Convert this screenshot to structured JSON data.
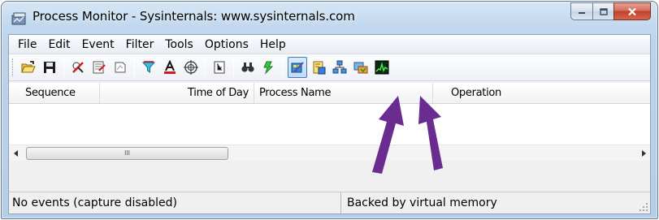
{
  "window": {
    "title": "Process Monitor - Sysinternals: www.sysinternals.com",
    "app_icon": "procmon-icon",
    "caption_buttons": [
      "minimize-icon",
      "maximize-icon",
      "close-icon"
    ]
  },
  "menubar": {
    "items": [
      {
        "label": "File"
      },
      {
        "label": "Edit"
      },
      {
        "label": "Event"
      },
      {
        "label": "Filter"
      },
      {
        "label": "Tools"
      },
      {
        "label": "Options"
      },
      {
        "label": "Help"
      }
    ]
  },
  "toolbar": {
    "buttons": [
      {
        "icon": "open-folder-icon"
      },
      {
        "icon": "save-icon"
      },
      {
        "icon": "capture-icon"
      },
      {
        "icon": "autoscroll-icon"
      },
      {
        "icon": "clear-icon"
      },
      {
        "icon": "filter-icon"
      },
      {
        "icon": "highlight-icon"
      },
      {
        "icon": "target-icon"
      },
      {
        "icon": "process-tree-icon"
      },
      {
        "icon": "find-icon"
      },
      {
        "icon": "jump-icon"
      },
      {
        "icon": "registry-activity-icon",
        "active": true
      },
      {
        "icon": "file-activity-icon"
      },
      {
        "icon": "network-activity-icon"
      },
      {
        "icon": "process-activity-icon"
      },
      {
        "icon": "profiling-icon"
      }
    ],
    "colors": {
      "active_border": "#3c7fb1",
      "active_bg": "#c1dbf6"
    }
  },
  "list": {
    "columns": [
      {
        "label": "Sequence"
      },
      {
        "label": "Time of Day"
      },
      {
        "label": "Process Name"
      },
      {
        "label": "Operation"
      }
    ],
    "rows": [],
    "scrollbar_thumb_glyph": "III"
  },
  "statusbar": {
    "left": "No events (capture disabled)",
    "right": "Backed by virtual memory"
  },
  "annotation": {
    "arrow_color": "#6b2c8f"
  }
}
